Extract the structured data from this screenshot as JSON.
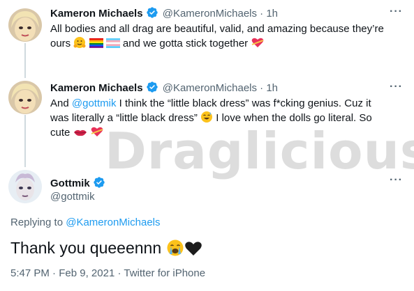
{
  "tweets": [
    {
      "name": "Kameron Michaels",
      "handle": "@KameronMichaels",
      "dot": "·",
      "time": "1h",
      "text_a": "All bodies and all drag are beautiful, valid, and amazing because they’re",
      "text_b_pre": "ours",
      "text_b_post": "and we gotta stick together",
      "icons": [
        "hug-emoji",
        "rainbow-flag-emoji",
        "trans-flag-emoji",
        "heart-ribbon-emoji"
      ]
    },
    {
      "name": "Kameron Michaels",
      "handle": "@KameronMichaels",
      "dot": "·",
      "time": "1h",
      "line1_pre": "And",
      "mention": "@gottmik",
      "line1_post": "I think the “little black dress” was f*cking genius. Cuz it",
      "line2_pre": "was literally a “little black dress”",
      "line2_post": "I love when the dolls go literal. So",
      "line3": "cute",
      "icons": [
        "sweat-smile-emoji",
        "lips-emoji",
        "heart-ribbon-emoji"
      ]
    }
  ],
  "main_tweet": {
    "name": "Gottmik",
    "handle": "@gottmik",
    "replying_label": "Replying to",
    "replying_to": "@KameronMichaels",
    "text": "Thank you queeennn",
    "timestamp": "5:47 PM",
    "date": "Feb 9, 2021",
    "source": "Twitter for iPhone",
    "meta_dot": "·",
    "icons": [
      "crying-emoji",
      "black-heart-emoji"
    ]
  },
  "more_label": "···",
  "watermark": "Draglicious",
  "colors": {
    "link": "#1d9bf0",
    "muted": "#536471",
    "verified": "#1d9bf0",
    "text": "#0f1419"
  }
}
